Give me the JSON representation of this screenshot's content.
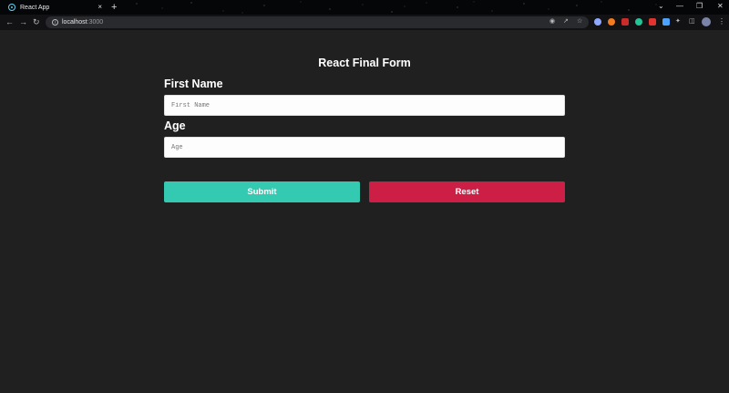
{
  "browser": {
    "tab_title": "React App",
    "tab_close": "×",
    "new_tab": "+",
    "url_host": "localhost",
    "url_port": ":3000",
    "window_controls": [
      "⌄",
      "—",
      "❐",
      "✕"
    ],
    "extension_colors": [
      "#8ea8ff",
      "#f47a1e",
      "#cc2b2b",
      "#25c497",
      "#e0342f",
      "#4aa3ff"
    ]
  },
  "form": {
    "title": "React Final Form",
    "first_name": {
      "label": "First Name",
      "placeholder": "First Name",
      "value": ""
    },
    "age": {
      "label": "Age",
      "placeholder": "Age",
      "value": ""
    },
    "submit_label": "Submit",
    "reset_label": "Reset"
  },
  "colors": {
    "background": "#202020",
    "submit": "#34c9b1",
    "reset": "#cd1f45"
  }
}
